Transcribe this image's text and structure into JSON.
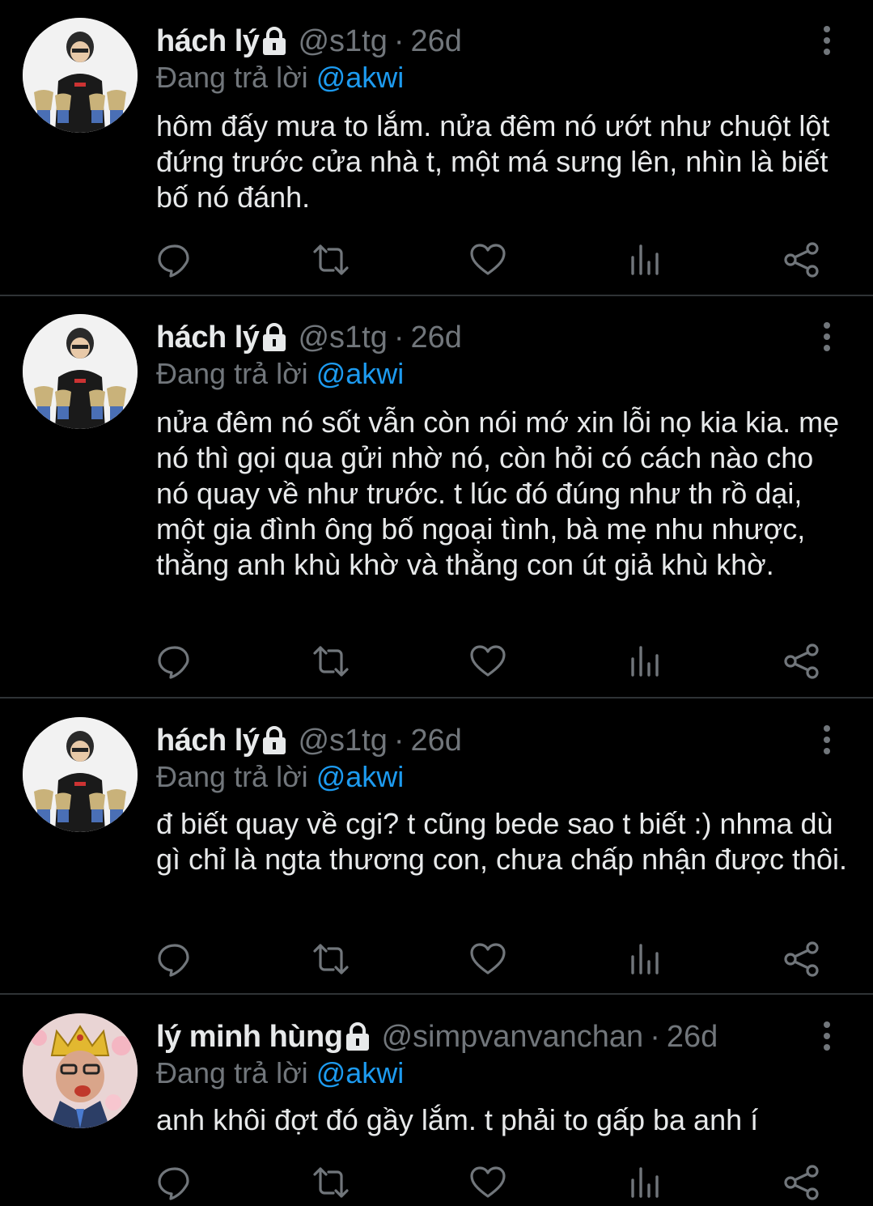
{
  "tweets": [
    {
      "name": "hách lý",
      "handle": "@s1tg",
      "sep": "·",
      "time": "26d",
      "replying_label": "Đang trả lời",
      "mention": "@akwi",
      "text": "hôm đấy mưa to lắm. nửa đêm nó ướt như chuột lột đứng trước cửa nhà t, một má sưng lên, nhìn là biết bố nó đánh.",
      "avatar": "player-with-trophies"
    },
    {
      "name": "hách lý",
      "handle": "@s1tg",
      "sep": "·",
      "time": "26d",
      "replying_label": "Đang trả lời",
      "mention": "@akwi",
      "text": "nửa đêm nó sốt vẫn còn nói mớ xin lỗi nọ kia kia. mẹ nó thì gọi qua gửi nhờ nó, còn hỏi có cách nào cho nó quay về như trước. t lúc đó đúng như th rồ dại, một gia đình ông bố ngoại tình, bà mẹ nhu nhược, thằng anh khù khờ và thằng con út giả khù khờ.",
      "avatar": "player-with-trophies"
    },
    {
      "name": "hách lý",
      "handle": "@s1tg",
      "sep": "·",
      "time": "26d",
      "replying_label": "Đang trả lời",
      "mention": "@akwi",
      "text": "đ biết quay về cgi? t cũng bede sao t biết :) nhma dù gì chỉ là ngta thương con, chưa chấp nhận được thôi.",
      "avatar": "player-with-trophies"
    },
    {
      "name": "lý minh hùng",
      "handle": "@simpvanvanchan",
      "sep": "·",
      "time": "26d",
      "replying_label": "Đang trả lời",
      "mention": "@akwi",
      "text": "anh khôi đợt đó gầy lắm. t phải to gấp ba anh í",
      "avatar": "man-with-crown"
    }
  ],
  "icons": {
    "lock": "lock-icon",
    "more": "more-vertical-icon",
    "reply": "reply-icon",
    "retweet": "retweet-icon",
    "like": "heart-icon",
    "views": "analytics-icon",
    "share": "share-icon"
  },
  "colors": {
    "background": "#000000",
    "text": "#e7e9ea",
    "muted": "#71767b",
    "link": "#1d9bf0",
    "divider": "#2f3336"
  }
}
